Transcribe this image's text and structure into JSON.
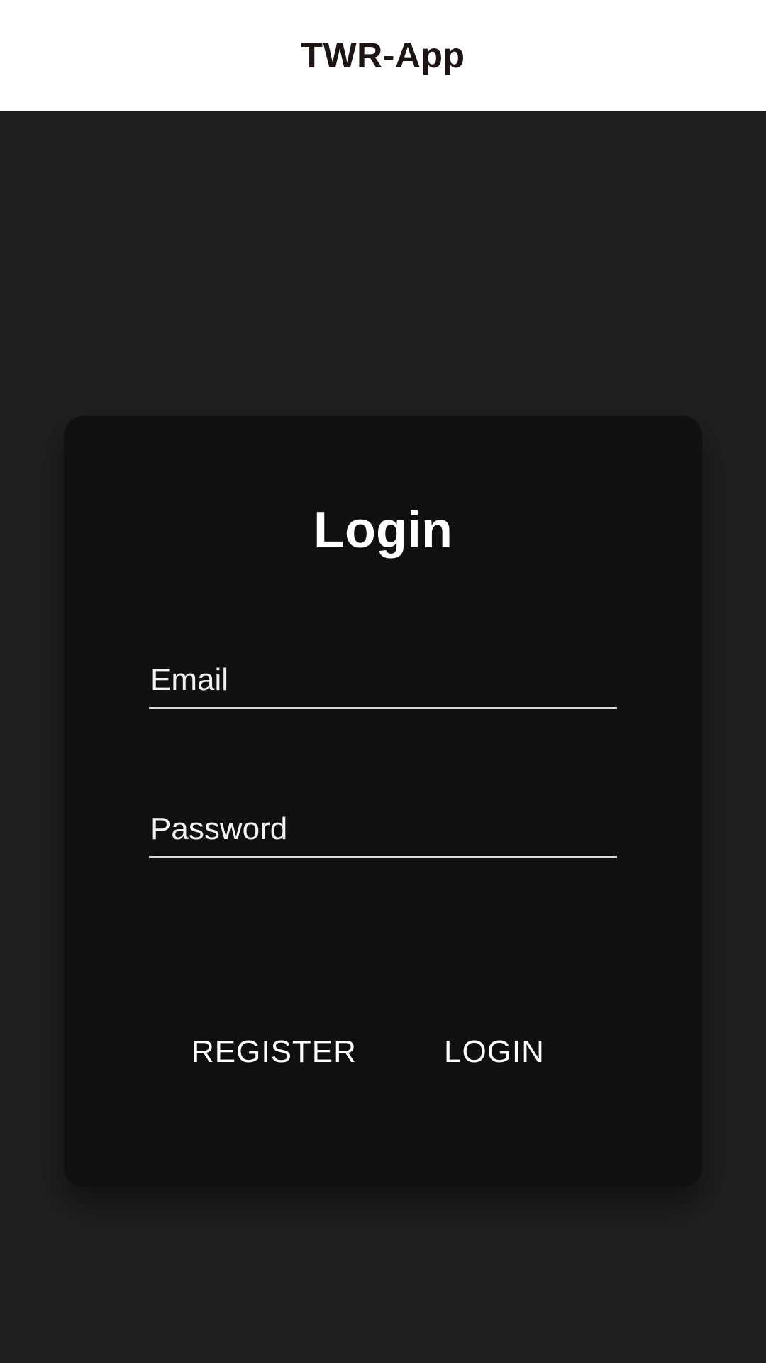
{
  "app_bar": {
    "title": "TWR-App",
    "background": "#ffffff",
    "title_color": "#1c1514"
  },
  "login_card": {
    "title": "Login",
    "email": {
      "placeholder": "Email",
      "value": ""
    },
    "password": {
      "placeholder": "Password",
      "value": ""
    },
    "register_label": "REGISTER",
    "login_label": "LOGIN"
  },
  "colors": {
    "page_background": "#1f1f1f",
    "card_background": "#101010",
    "text": "#ffffff",
    "field_underline": "#d9d9d9"
  }
}
